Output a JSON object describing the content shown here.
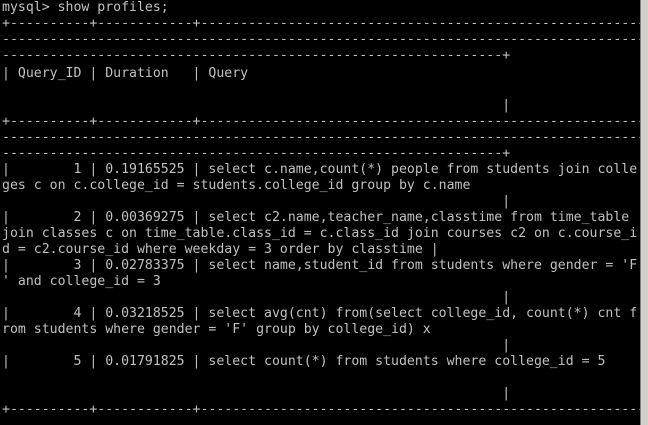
{
  "console": {
    "lines": [
      "mysql> show profiles;",
      "+----------+------------+------------------------------------------------------------------------------------------",
      "--------------------------------------------------------------------------------------------------------------------",
      "---------------------------------------------------------------+",
      "| Query_ID | Duration   | Query",
      "",
      "                                                               |",
      "+----------+------------+------------------------------------------------------------------------------------------",
      "--------------------------------------------------------------------------------------------------------------------",
      "---------------------------------------------------------------+",
      "|        1 | 0.19165525 | select c.name,count(*) people from students join colle",
      "ges c on c.college_id = students.college_id group by c.name",
      "                                                               |",
      "|        2 | 0.00369275 | select c2.name,teacher_name,classtime from time_table",
      "join classes c on time_table.class_id = c.class_id join courses c2 on c.course_i",
      "d = c2.course_id where weekday = 3 order by classtime |",
      "|        3 | 0.02783375 | select name,student_id from students where gender = 'F",
      "' and college_id = 3",
      "                                                               |",
      "|        4 | 0.03218525 | select avg(cnt) from(select college_id, count(*) cnt f",
      "rom students where gender = 'F' group by college_id) x",
      "                                                               |",
      "|        5 | 0.01791825 | select count(*) from students where college_id = 5",
      "",
      "                                                               |",
      "+----------+------------+------------------------------------------------------------------------------------------"
    ]
  },
  "colors": {
    "background": "#000000",
    "text": "#c0c0c0"
  }
}
